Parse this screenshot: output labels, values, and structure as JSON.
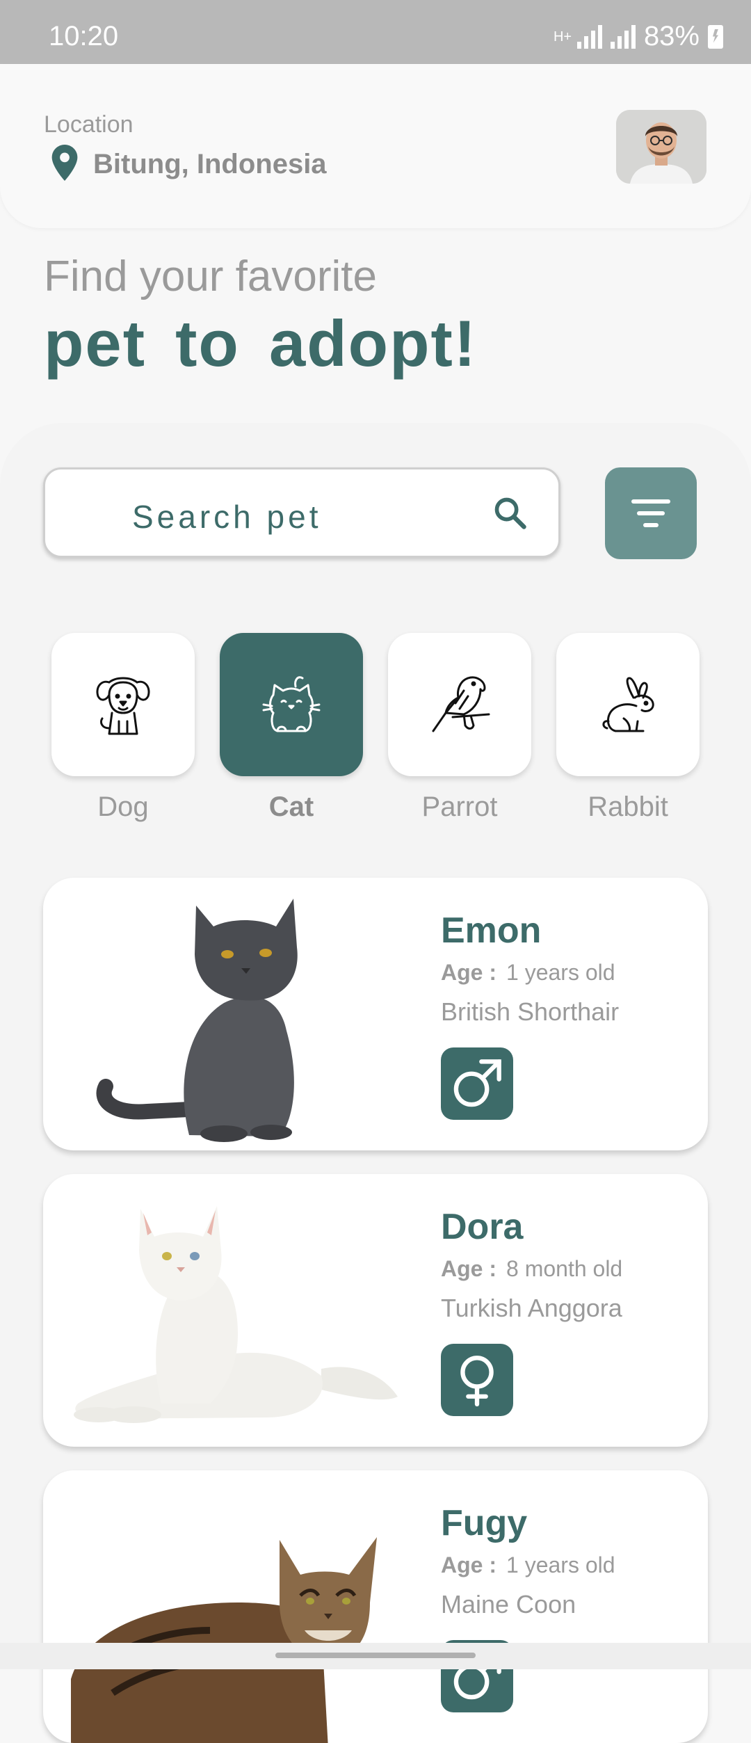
{
  "status_bar": {
    "time": "10:20",
    "network": "H+",
    "battery": "83%"
  },
  "header": {
    "location_label": "Location",
    "location_value": "Bitung, Indonesia"
  },
  "headline": {
    "line1": "Find your favorite",
    "line2": "pet to adopt!"
  },
  "search": {
    "placeholder": "Search pet"
  },
  "categories": [
    {
      "label": "Dog",
      "icon": "dog-icon",
      "selected": false
    },
    {
      "label": "Cat",
      "icon": "cat-icon",
      "selected": true
    },
    {
      "label": "Parrot",
      "icon": "parrot-icon",
      "selected": false
    },
    {
      "label": "Rabbit",
      "icon": "rabbit-icon",
      "selected": false
    }
  ],
  "pets": [
    {
      "name": "Emon",
      "age_label": "Age :",
      "age": "1 years old",
      "breed": "British Shorthair",
      "gender": "male-icon"
    },
    {
      "name": "Dora",
      "age_label": "Age :",
      "age": "8 month old",
      "breed": "Turkish Anggora",
      "gender": "female-icon"
    },
    {
      "name": "Fugy",
      "age_label": "Age :",
      "age": "1 years old",
      "breed": "Maine Coon",
      "gender": "male-icon"
    }
  ],
  "colors": {
    "primary": "#3d6b69",
    "filter_button": "#6a9391",
    "muted_text": "#9a9a9a",
    "status_bar": "#b8b8b8"
  }
}
